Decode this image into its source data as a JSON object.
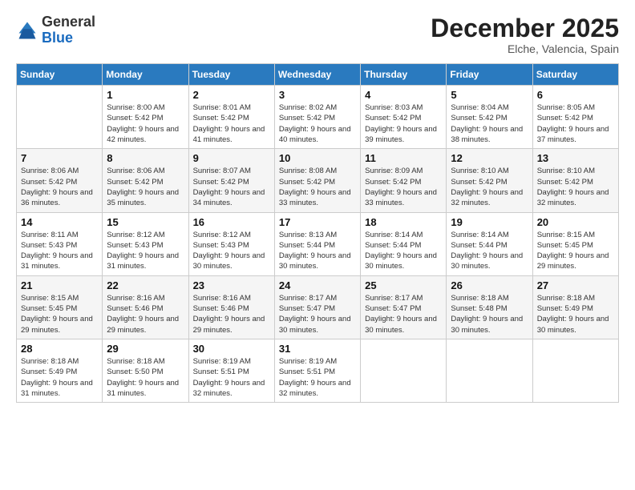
{
  "logo": {
    "general": "General",
    "blue": "Blue"
  },
  "title": "December 2025",
  "location": "Elche, Valencia, Spain",
  "days_of_week": [
    "Sunday",
    "Monday",
    "Tuesday",
    "Wednesday",
    "Thursday",
    "Friday",
    "Saturday"
  ],
  "weeks": [
    [
      {
        "day": "",
        "sunrise": "",
        "sunset": "",
        "daylight": ""
      },
      {
        "day": "1",
        "sunrise": "Sunrise: 8:00 AM",
        "sunset": "Sunset: 5:42 PM",
        "daylight": "Daylight: 9 hours and 42 minutes."
      },
      {
        "day": "2",
        "sunrise": "Sunrise: 8:01 AM",
        "sunset": "Sunset: 5:42 PM",
        "daylight": "Daylight: 9 hours and 41 minutes."
      },
      {
        "day": "3",
        "sunrise": "Sunrise: 8:02 AM",
        "sunset": "Sunset: 5:42 PM",
        "daylight": "Daylight: 9 hours and 40 minutes."
      },
      {
        "day": "4",
        "sunrise": "Sunrise: 8:03 AM",
        "sunset": "Sunset: 5:42 PM",
        "daylight": "Daylight: 9 hours and 39 minutes."
      },
      {
        "day": "5",
        "sunrise": "Sunrise: 8:04 AM",
        "sunset": "Sunset: 5:42 PM",
        "daylight": "Daylight: 9 hours and 38 minutes."
      },
      {
        "day": "6",
        "sunrise": "Sunrise: 8:05 AM",
        "sunset": "Sunset: 5:42 PM",
        "daylight": "Daylight: 9 hours and 37 minutes."
      }
    ],
    [
      {
        "day": "7",
        "sunrise": "Sunrise: 8:06 AM",
        "sunset": "Sunset: 5:42 PM",
        "daylight": "Daylight: 9 hours and 36 minutes."
      },
      {
        "day": "8",
        "sunrise": "Sunrise: 8:06 AM",
        "sunset": "Sunset: 5:42 PM",
        "daylight": "Daylight: 9 hours and 35 minutes."
      },
      {
        "day": "9",
        "sunrise": "Sunrise: 8:07 AM",
        "sunset": "Sunset: 5:42 PM",
        "daylight": "Daylight: 9 hours and 34 minutes."
      },
      {
        "day": "10",
        "sunrise": "Sunrise: 8:08 AM",
        "sunset": "Sunset: 5:42 PM",
        "daylight": "Daylight: 9 hours and 33 minutes."
      },
      {
        "day": "11",
        "sunrise": "Sunrise: 8:09 AM",
        "sunset": "Sunset: 5:42 PM",
        "daylight": "Daylight: 9 hours and 33 minutes."
      },
      {
        "day": "12",
        "sunrise": "Sunrise: 8:10 AM",
        "sunset": "Sunset: 5:42 PM",
        "daylight": "Daylight: 9 hours and 32 minutes."
      },
      {
        "day": "13",
        "sunrise": "Sunrise: 8:10 AM",
        "sunset": "Sunset: 5:42 PM",
        "daylight": "Daylight: 9 hours and 32 minutes."
      }
    ],
    [
      {
        "day": "14",
        "sunrise": "Sunrise: 8:11 AM",
        "sunset": "Sunset: 5:43 PM",
        "daylight": "Daylight: 9 hours and 31 minutes."
      },
      {
        "day": "15",
        "sunrise": "Sunrise: 8:12 AM",
        "sunset": "Sunset: 5:43 PM",
        "daylight": "Daylight: 9 hours and 31 minutes."
      },
      {
        "day": "16",
        "sunrise": "Sunrise: 8:12 AM",
        "sunset": "Sunset: 5:43 PM",
        "daylight": "Daylight: 9 hours and 30 minutes."
      },
      {
        "day": "17",
        "sunrise": "Sunrise: 8:13 AM",
        "sunset": "Sunset: 5:44 PM",
        "daylight": "Daylight: 9 hours and 30 minutes."
      },
      {
        "day": "18",
        "sunrise": "Sunrise: 8:14 AM",
        "sunset": "Sunset: 5:44 PM",
        "daylight": "Daylight: 9 hours and 30 minutes."
      },
      {
        "day": "19",
        "sunrise": "Sunrise: 8:14 AM",
        "sunset": "Sunset: 5:44 PM",
        "daylight": "Daylight: 9 hours and 30 minutes."
      },
      {
        "day": "20",
        "sunrise": "Sunrise: 8:15 AM",
        "sunset": "Sunset: 5:45 PM",
        "daylight": "Daylight: 9 hours and 29 minutes."
      }
    ],
    [
      {
        "day": "21",
        "sunrise": "Sunrise: 8:15 AM",
        "sunset": "Sunset: 5:45 PM",
        "daylight": "Daylight: 9 hours and 29 minutes."
      },
      {
        "day": "22",
        "sunrise": "Sunrise: 8:16 AM",
        "sunset": "Sunset: 5:46 PM",
        "daylight": "Daylight: 9 hours and 29 minutes."
      },
      {
        "day": "23",
        "sunrise": "Sunrise: 8:16 AM",
        "sunset": "Sunset: 5:46 PM",
        "daylight": "Daylight: 9 hours and 29 minutes."
      },
      {
        "day": "24",
        "sunrise": "Sunrise: 8:17 AM",
        "sunset": "Sunset: 5:47 PM",
        "daylight": "Daylight: 9 hours and 30 minutes."
      },
      {
        "day": "25",
        "sunrise": "Sunrise: 8:17 AM",
        "sunset": "Sunset: 5:47 PM",
        "daylight": "Daylight: 9 hours and 30 minutes."
      },
      {
        "day": "26",
        "sunrise": "Sunrise: 8:18 AM",
        "sunset": "Sunset: 5:48 PM",
        "daylight": "Daylight: 9 hours and 30 minutes."
      },
      {
        "day": "27",
        "sunrise": "Sunrise: 8:18 AM",
        "sunset": "Sunset: 5:49 PM",
        "daylight": "Daylight: 9 hours and 30 minutes."
      }
    ],
    [
      {
        "day": "28",
        "sunrise": "Sunrise: 8:18 AM",
        "sunset": "Sunset: 5:49 PM",
        "daylight": "Daylight: 9 hours and 31 minutes."
      },
      {
        "day": "29",
        "sunrise": "Sunrise: 8:18 AM",
        "sunset": "Sunset: 5:50 PM",
        "daylight": "Daylight: 9 hours and 31 minutes."
      },
      {
        "day": "30",
        "sunrise": "Sunrise: 8:19 AM",
        "sunset": "Sunset: 5:51 PM",
        "daylight": "Daylight: 9 hours and 32 minutes."
      },
      {
        "day": "31",
        "sunrise": "Sunrise: 8:19 AM",
        "sunset": "Sunset: 5:51 PM",
        "daylight": "Daylight: 9 hours and 32 minutes."
      },
      {
        "day": "",
        "sunrise": "",
        "sunset": "",
        "daylight": ""
      },
      {
        "day": "",
        "sunrise": "",
        "sunset": "",
        "daylight": ""
      },
      {
        "day": "",
        "sunrise": "",
        "sunset": "",
        "daylight": ""
      }
    ]
  ]
}
